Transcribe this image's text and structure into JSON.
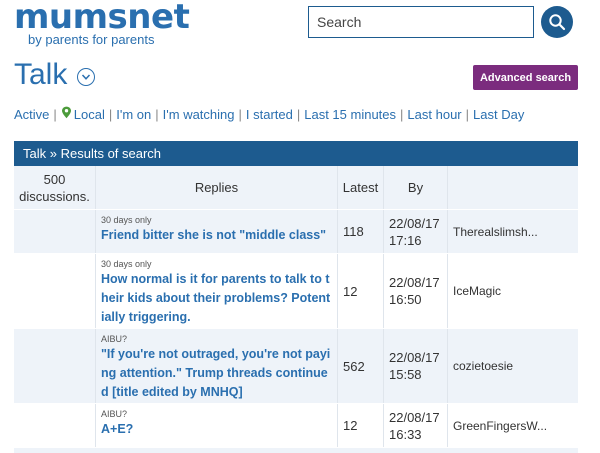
{
  "logo": {
    "name": "mumsnet",
    "tagline": "by parents for parents"
  },
  "search": {
    "placeholder": "Search"
  },
  "page": {
    "title": "Talk",
    "advanced_search": "Advanced search"
  },
  "filters": [
    "Active",
    "Local",
    "I'm on",
    "I'm watching",
    "I started",
    "Last 15 minutes",
    "Last hour",
    "Last Day"
  ],
  "breadcrumb": {
    "talk": "Talk",
    "sep": "»",
    "current": "Results of search"
  },
  "table": {
    "count": "500",
    "count_label": "discussions.",
    "headers": {
      "replies": "Replies",
      "latest": "Latest",
      "by": "By"
    },
    "rows": [
      {
        "topic": "30 days only",
        "title": "Friend bitter she is not \"middle class\"",
        "replies": "118",
        "date": "22/08/17",
        "time": "17:16",
        "by": "Therealslimsh..."
      },
      {
        "topic": "30 days only",
        "title": "How normal is it for parents to talk to their kids about their problems? Potentially triggering.",
        "replies": "12",
        "date": "22/08/17",
        "time": "16:50",
        "by": "IceMagic"
      },
      {
        "topic": "AIBU?",
        "title": "\"If you're not outraged, you're not paying attention.\" Trump threads continued [title edited by MNHQ]",
        "replies": "562",
        "date": "22/08/17",
        "time": "15:58",
        "by": "cozietoesie"
      },
      {
        "topic": "AIBU?",
        "title": "A+E?",
        "replies": "12",
        "date": "22/08/17",
        "time": "16:33",
        "by": "GreenFingersW..."
      }
    ]
  },
  "colors": {
    "brand": "#2a6faf",
    "header_bar": "#1d5b8f",
    "advanced_button": "#7b2c7e",
    "row_alt": "#eef3f9"
  }
}
